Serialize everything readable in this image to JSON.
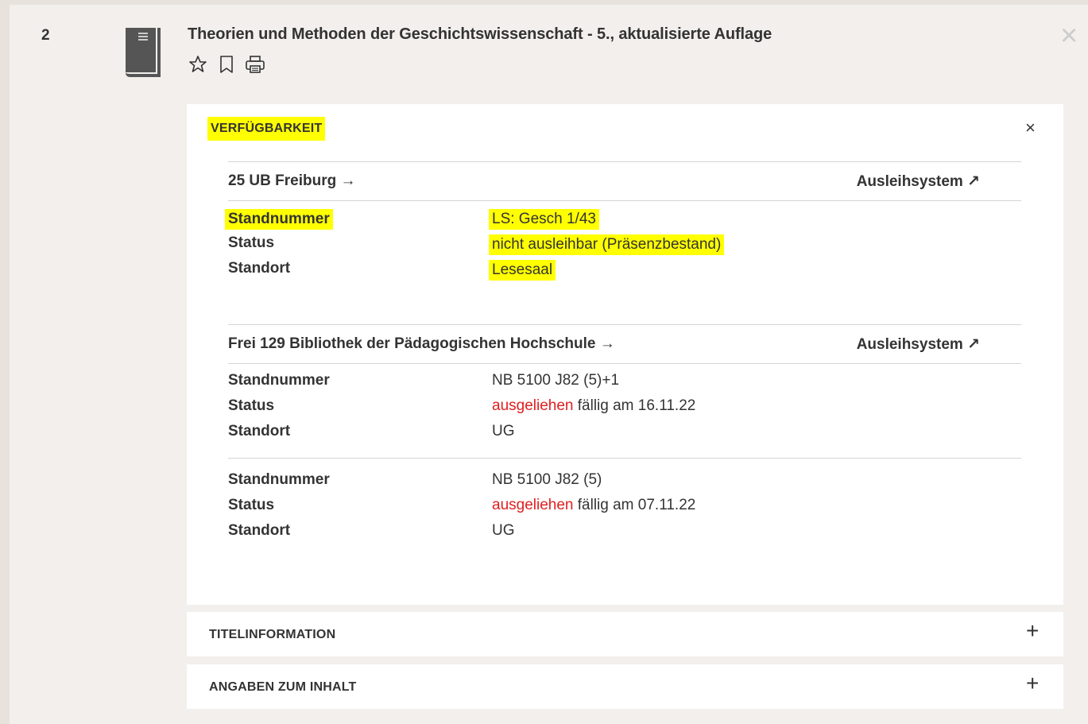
{
  "record": {
    "number": "2",
    "title": "Theorien und Methoden der Geschichtswissenschaft - 5., aktualisierte Auflage",
    "actions": [
      "star-icon",
      "bookmark-icon",
      "print-icon"
    ]
  },
  "availability": {
    "header": "VERFÜGBARKEIT",
    "holdings": [
      {
        "location": "25 UB Freiburg →",
        "link": "Ausleihsystem ↗",
        "items": [
          {
            "standnummer_label": "Standnummer",
            "standnummer": "LS: Gesch 1/43",
            "status_label": "Status",
            "status": "nicht ausleihbar (Präsenzbestand)",
            "status_suffix": "",
            "standort_label": "Standort",
            "standort": "Lesesaal"
          }
        ]
      },
      {
        "location": "Frei 129 Bibliothek der Pädagogischen Hochschule →",
        "link": "Ausleihsystem ↗",
        "items": [
          {
            "standnummer_label": "Standnummer",
            "standnummer": "NB 5100 J82 (5)+1",
            "status_label": "Status",
            "status": "ausgeliehen",
            "status_suffix": " fällig am 16.11.22",
            "standort_label": "Standort",
            "standort": "UG"
          },
          {
            "standnummer_label": "Standnummer",
            "standnummer": "NB 5100 J82 (5)",
            "status_label": "Status",
            "status": "ausgeliehen",
            "status_suffix": " fällig am 07.11.22",
            "standort_label": "Standort",
            "standort": "UG"
          }
        ]
      }
    ]
  },
  "sections": {
    "titelinformation": "TITELINFORMATION",
    "angaben": "ANGABEN ZUM INHALT",
    "expand_symbol": "+",
    "close_symbol": "×"
  },
  "colors": {
    "highlight": "#ffff00",
    "loaned": "#e02020"
  }
}
